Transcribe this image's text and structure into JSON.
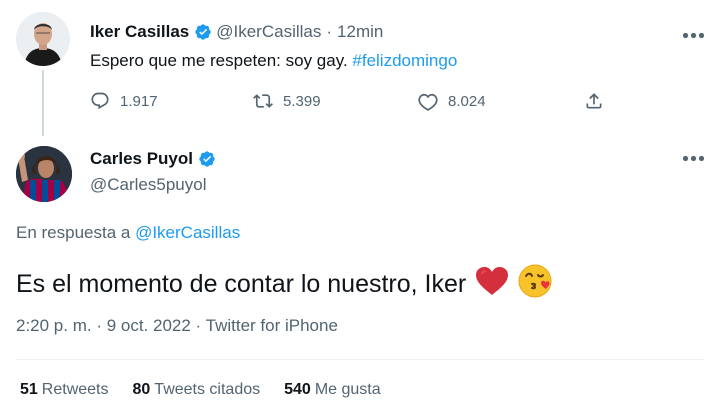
{
  "tweet1": {
    "author_name": "Iker Casillas",
    "handle": "@IkerCasillas",
    "separator": "·",
    "time": "12min",
    "text_plain": "Espero que me respeten: soy gay. ",
    "hashtag": "#felizdomingo",
    "replies": "1.917",
    "retweets": "5.399",
    "likes": "8.024"
  },
  "tweet2": {
    "author_name": "Carles Puyol",
    "handle": "@Carles5puyol",
    "reply_prefix": "En respuesta a ",
    "reply_handle": "@IkerCasillas",
    "text": "Es el momento de contar lo nuestro, Iker",
    "meta": "2:20 p. m. · 9 oct. 2022 · Twitter for iPhone",
    "stats": [
      {
        "count": "51",
        "label": "Retweets"
      },
      {
        "count": "80",
        "label": "Tweets citados"
      },
      {
        "count": "540",
        "label": "Me gusta"
      }
    ]
  },
  "colors": {
    "accent": "#1d9bf0",
    "muted": "#536471",
    "heart": "#d32f3c"
  },
  "icons": [
    "verified-badge-icon",
    "more-options-icon",
    "reply-icon",
    "retweet-icon",
    "like-icon",
    "share-icon",
    "red-heart-emoji",
    "kissing-face-emoji"
  ]
}
